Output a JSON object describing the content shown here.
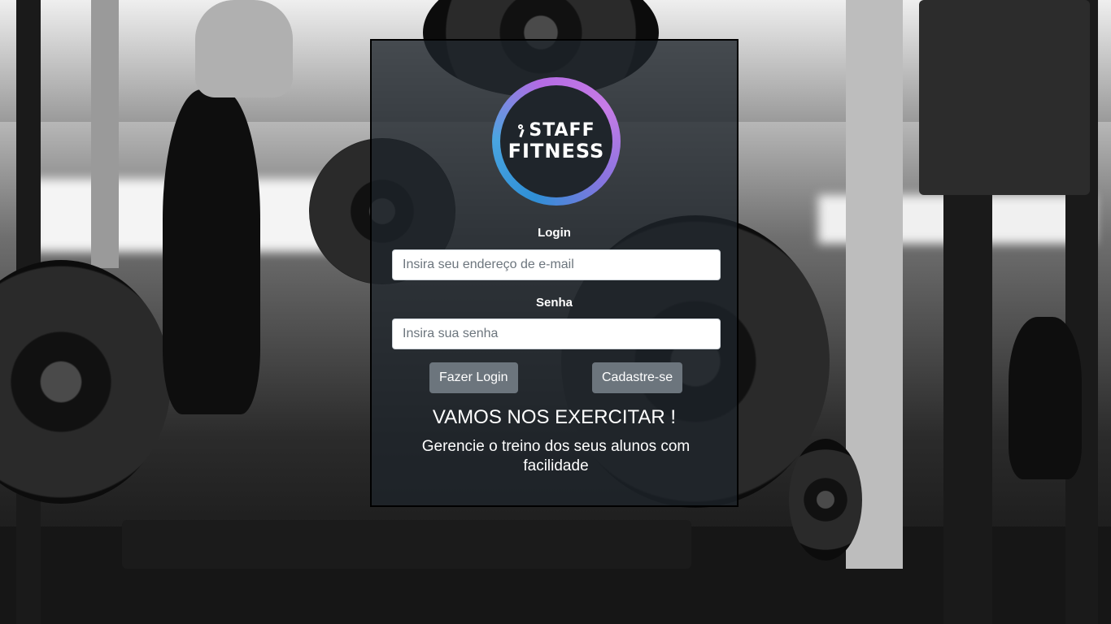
{
  "brand": {
    "line1": "STAFF",
    "line2": "FITNESS",
    "ring_colors": [
      "#2f8fd6",
      "#c77ce6"
    ]
  },
  "login_form": {
    "email_label": "Login",
    "email_placeholder": "Insira seu endereço de e-mail",
    "password_label": "Senha",
    "password_placeholder": "Insira sua senha",
    "login_button": "Fazer Login",
    "signup_button": "Cadastre-se"
  },
  "tagline": {
    "headline": "VAMOS NOS EXERCITAR !",
    "subtext": "Gerencie o treino dos seus alunos com facilidade"
  },
  "colors": {
    "button": "#6c757d",
    "card_bg": "#1e242a"
  }
}
